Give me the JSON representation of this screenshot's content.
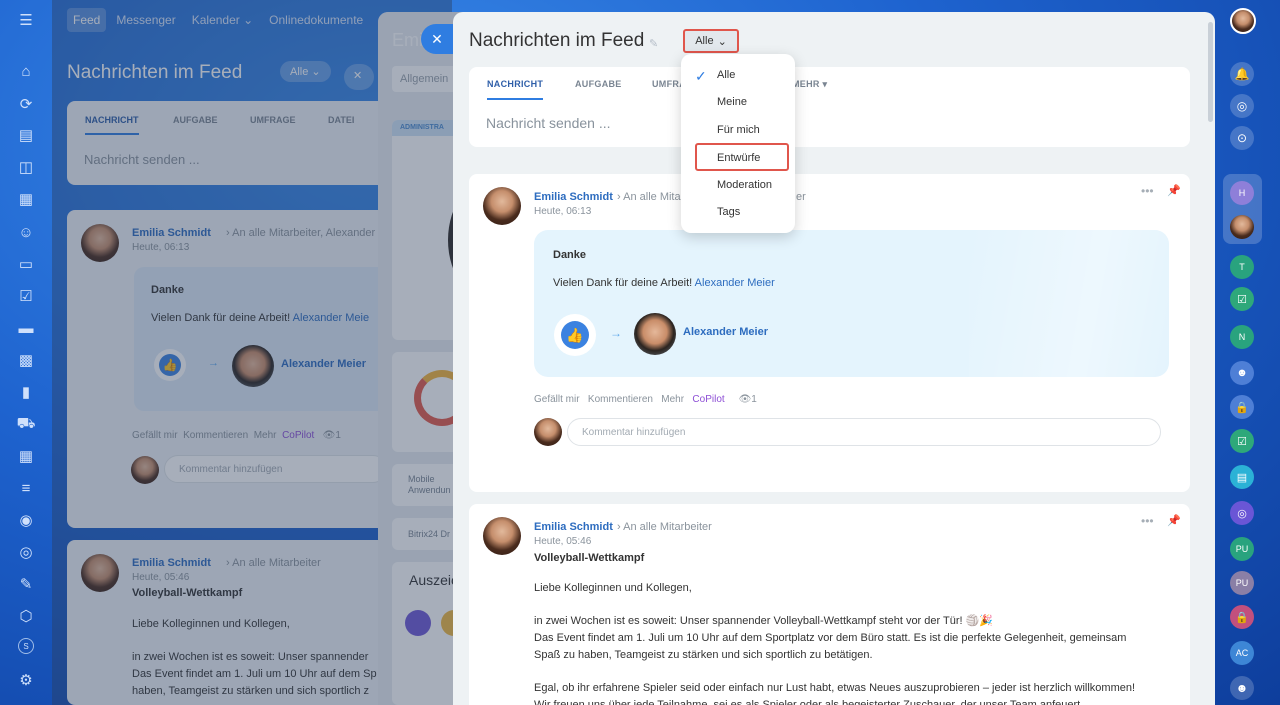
{
  "nav": {
    "feed": "Feed",
    "messenger": "Messenger",
    "calendar": "Kalender",
    "onlinedocs": "Onlinedokumente"
  },
  "back": {
    "title": "Nachrichten im Feed",
    "filter": "Alle",
    "tabs": [
      "NACHRICHT",
      "AUFGABE",
      "UMFRAGE",
      "DATEI"
    ],
    "send": "Nachricht senden ...",
    "post1": {
      "author": "Emilia Schmidt",
      "dest": "An alle Mitarbeiter, Alexander M",
      "time": "Heute, 06:13",
      "title": "Danke",
      "text": "Vielen Dank für deine Arbeit!",
      "mention": "Alexander Meie",
      "target": "Alexander Meier",
      "actions": [
        "Gefällt mir",
        "Kommentieren",
        "Mehr",
        "CoPilot"
      ],
      "views": "1",
      "comment": "Kommentar hinzufügen"
    },
    "post2": {
      "author": "Emilia Schmidt",
      "dest": "An alle Mitarbeiter",
      "time": "Heute, 05:46",
      "title": "Volleyball-Wettkampf",
      "greeting": "Liebe Kolleginnen und Kollegen,",
      "l1": "in zwei Wochen ist es soweit: Unser spannender",
      "l2": "Das Event findet am 1. Juli um 10 Uhr auf dem Sp",
      "l3": "haben, Teamgeist zu stärken und sich sportlich z"
    }
  },
  "layer2": {
    "title": "Emi",
    "general": "Allgemein",
    "admin": "ADMINISTRA",
    "mobile1": "Mobile",
    "mobile2": "Anwendun",
    "bitrix": "Bitrix24 Dr",
    "awards": "Auszeic"
  },
  "panel": {
    "title": "Nachrichten im Feed",
    "filter": "Alle",
    "tabs": [
      "NACHRICHT",
      "AUFGABE",
      "UMFRA",
      "MEHR"
    ],
    "send": "Nachricht senden ...",
    "post1": {
      "author": "Emilia Schmidt",
      "dest": "An alle Mitar",
      "dest2": "er",
      "time": "Heute, 06:13",
      "title": "Danke",
      "text": "Vielen Dank für deine Arbeit!",
      "mention": "Alexander Meier",
      "target": "Alexander Meier",
      "actions": [
        "Gefällt mir",
        "Kommentieren",
        "Mehr",
        "CoPilot"
      ],
      "views": "1",
      "comment": "Kommentar hinzufügen"
    },
    "post2": {
      "author": "Emilia Schmidt",
      "dest": "An alle Mitarbeiter",
      "time": "Heute, 05:46",
      "title": "Volleyball-Wettkampf",
      "greeting": "Liebe Kolleginnen und Kollegen,",
      "p1": "in zwei Wochen ist es soweit: Unser spannender Volleyball-Wettkampf steht vor der Tür! 🏐🎉",
      "p2": "Das Event findet am 1. Juli um 10 Uhr auf dem Sportplatz vor dem Büro statt. Es ist die perfekte Gelegenheit, gemeinsam",
      "p3": "Spaß zu haben, Teamgeist zu stärken und sich sportlich zu betätigen.",
      "p4": "Egal, ob ihr erfahrene Spieler seid oder einfach nur Lust habt, etwas Neues auszuprobieren – jeder ist herzlich willkommen!",
      "p5": "Wir freuen uns über jede Teilnahme, sei es als Spieler oder als begeisterter Zuschauer, der unser Team anfeuert."
    }
  },
  "menu": {
    "items": [
      "Alle",
      "Meine",
      "Für mich",
      "Entwürfe",
      "Moderation",
      "Tags"
    ],
    "selected": "Alle",
    "highlighted": "Entwürfe"
  },
  "rrail": {
    "initials": [
      "H",
      "T",
      "N",
      "PU",
      "PU",
      "AC"
    ]
  },
  "left_small": "S",
  "colors": {
    "accent": "#2f7de1",
    "highlight": "#e0564c",
    "link": "#2d6cbf",
    "copilot": "#8e4fd6"
  }
}
